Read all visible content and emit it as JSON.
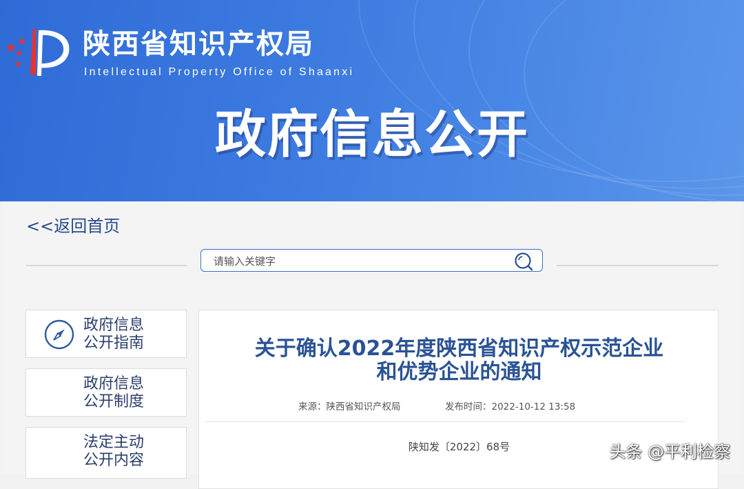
{
  "header": {
    "org_name_cn": "陕西省知识产权局",
    "org_name_en": "Intellectual Property Office of Shaanxi",
    "banner_title": "政府信息公开",
    "brand_color": "#3c7ae0"
  },
  "nav": {
    "back_label": "<<返回首页"
  },
  "search": {
    "placeholder": "请输入关键字",
    "value": "",
    "icon": "search-icon"
  },
  "sidebar": {
    "items": [
      {
        "line1": "政府信息",
        "line2": "公开指南",
        "icon": "compass-icon"
      },
      {
        "line1": "政府信息",
        "line2": "公开制度"
      },
      {
        "line1": "法定主动",
        "line2": "公开内容"
      }
    ]
  },
  "article": {
    "title_line1": "关于确认2022年度陕西省知识产权示范企业",
    "title_line2": "和优势企业的通知",
    "source_label": "来源：",
    "source_value": "陕西省知识产权局",
    "time_label": "发布时间：",
    "time_value": "2022-10-12 13:58",
    "doc_number": "陕知发〔2022〕68号"
  },
  "watermark": "头条 @平利检察"
}
